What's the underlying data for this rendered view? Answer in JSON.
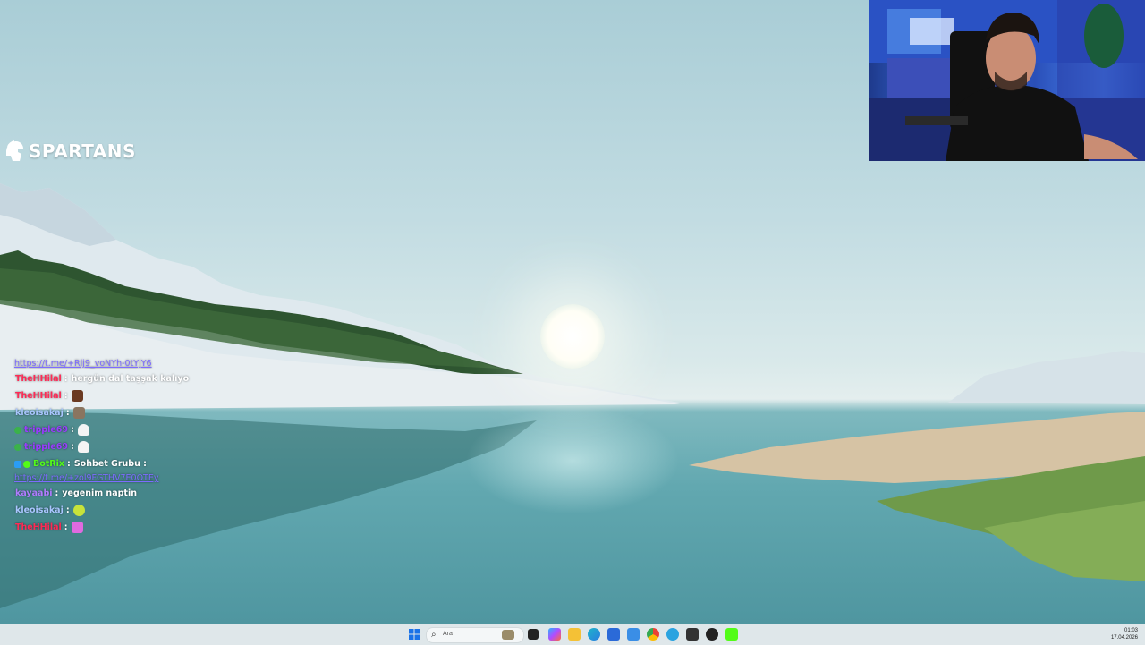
{
  "stream": {
    "logo_text": "SPARTANS"
  },
  "chat": {
    "messages": [
      {
        "type": "link",
        "text": "https://t.me/+Rlj9_voNYh-0tYjY6"
      },
      {
        "user": "TheHHilal",
        "user_color": "#ff2a55",
        "text": "hergün dal taşşak kalıyo",
        "emote": ""
      },
      {
        "user": "TheHHilal",
        "user_color": "#ff2a55",
        "text": "",
        "emote": "face-emote"
      },
      {
        "user": "kleoisakaj",
        "user_color": "#a9c6ff",
        "text": "",
        "emote": "portrait-emote"
      },
      {
        "user": "tripple69",
        "user_color": "#9a3cff",
        "text": "",
        "emote": "ghost-emote",
        "badge": "green-badge"
      },
      {
        "user": "tripple69",
        "user_color": "#9a3cff",
        "text": "",
        "emote": "ghost-emote",
        "badge": "green-badge"
      },
      {
        "user": "BotRix",
        "user_color": "#53fc18",
        "text": "Sohbet Grubu :",
        "emote": "",
        "badge": "bot-badge"
      },
      {
        "type": "link",
        "text": "https://t.me/+zol9FGTHV7E0OTEy"
      },
      {
        "user": "kayaabi",
        "user_color": "#b07cff",
        "text": "yegenim naptin",
        "emote": ""
      },
      {
        "user": "kleoisakaj",
        "user_color": "#a9c6ff",
        "text": "",
        "emote": "frog-emote"
      },
      {
        "user": "TheHHilal",
        "user_color": "#ff2a55",
        "text": "",
        "emote": "pink-emote"
      }
    ]
  },
  "taskbar": {
    "search_placeholder": "Ara",
    "time": "01:03",
    "date": "17.04.2026",
    "icons": [
      "start-icon",
      "search-icon",
      "widget-icon",
      "task-view-icon",
      "copilot-icon",
      "file-explorer-icon",
      "edge-icon",
      "store-icon",
      "photos-icon",
      "chrome-icon",
      "telegram-icon",
      "app-icon",
      "obs-icon",
      "kick-icon"
    ]
  },
  "colors": {
    "sky_top": "#a9cdd6",
    "water": "#62a8b0",
    "taskbar": "#dfe7ea",
    "link": "#7d6cff"
  }
}
